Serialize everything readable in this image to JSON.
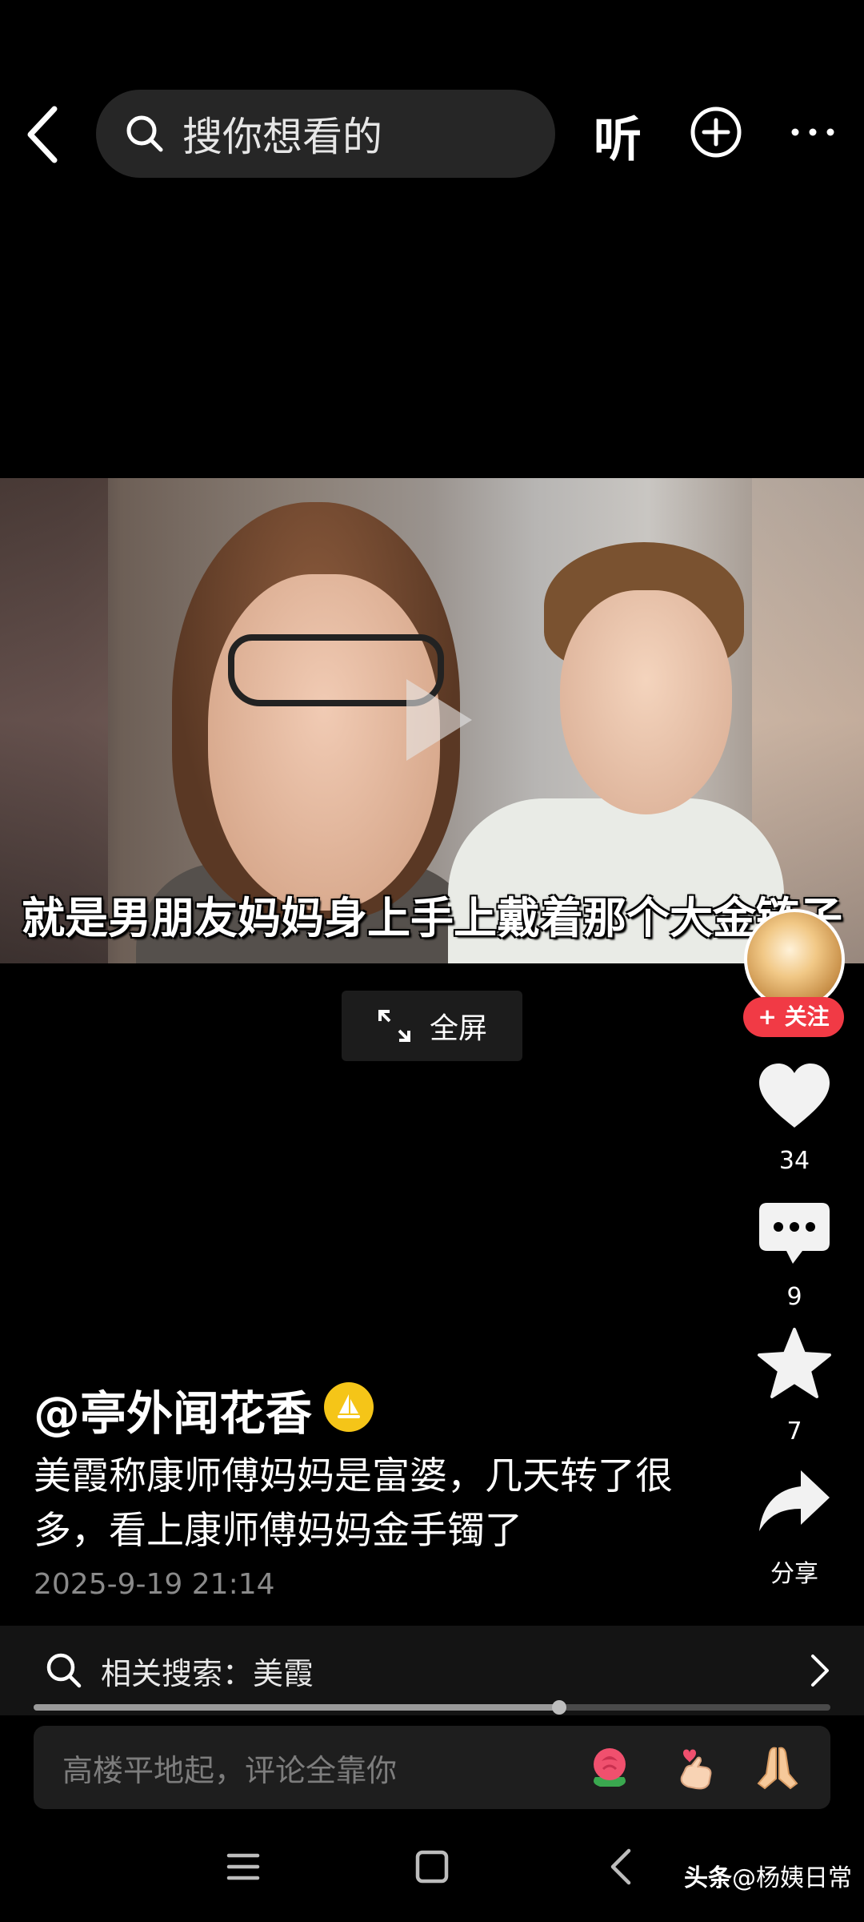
{
  "header": {
    "search_placeholder": "搜你想看的",
    "listen_label": "听"
  },
  "video": {
    "subtitle": "就是男朋友妈妈身上手上戴着那个大金链子",
    "fullscreen_label": "全屏"
  },
  "rail": {
    "follow_label": "+ 关注",
    "likes": "34",
    "comments": "9",
    "favorites": "7",
    "share_label": "分享"
  },
  "post": {
    "author": "@亭外闻花香",
    "description": "美霞称康师傅妈妈是富婆，几天转了很多，看上康师傅妈妈金手镯了",
    "date": "2025-9-19 21:14",
    "progress": 0.66
  },
  "related": {
    "label": "相关搜索：美霞"
  },
  "comment_bar": {
    "placeholder": "高楼平地起，评论全靠你"
  },
  "watermark": {
    "brand": "头条",
    "account": "@杨姨日常"
  },
  "colors": {
    "follow_red": "#f13a45",
    "badge_yellow": "#f5c518",
    "background": "#000000"
  }
}
